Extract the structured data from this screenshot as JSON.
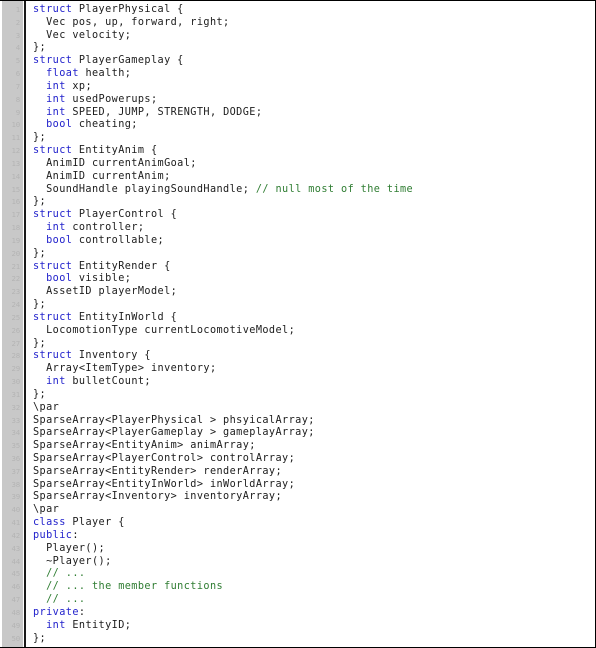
{
  "listing": {
    "language": "C++",
    "first_line_number": 1,
    "total_lines": 50,
    "colors": {
      "background": "#ffffff",
      "gutter": "#c8c8c8",
      "gutter_rule": "#1a1a1a",
      "line_number": "#b4b4b4",
      "text": "#1c1c1c",
      "keyword": "#2222cc",
      "comment": "#2f7d32",
      "border": "#000000"
    },
    "lines": [
      {
        "n": "1",
        "tokens": [
          {
            "t": "kw",
            "s": "struct"
          },
          {
            "t": "txt",
            "s": " PlayerPhysical {"
          }
        ]
      },
      {
        "n": "2",
        "tokens": [
          {
            "t": "txt",
            "s": "  Vec pos, up, forward, right;"
          }
        ]
      },
      {
        "n": "3",
        "tokens": [
          {
            "t": "txt",
            "s": "  Vec velocity;"
          }
        ]
      },
      {
        "n": "4",
        "tokens": [
          {
            "t": "txt",
            "s": "};"
          }
        ]
      },
      {
        "n": "5",
        "tokens": [
          {
            "t": "kw",
            "s": "struct"
          },
          {
            "t": "txt",
            "s": " PlayerGameplay {"
          }
        ]
      },
      {
        "n": "6",
        "tokens": [
          {
            "t": "txt",
            "s": "  "
          },
          {
            "t": "kw",
            "s": "float"
          },
          {
            "t": "txt",
            "s": " health;"
          }
        ]
      },
      {
        "n": "7",
        "tokens": [
          {
            "t": "txt",
            "s": "  "
          },
          {
            "t": "kw",
            "s": "int"
          },
          {
            "t": "txt",
            "s": " xp;"
          }
        ]
      },
      {
        "n": "8",
        "tokens": [
          {
            "t": "txt",
            "s": "  "
          },
          {
            "t": "kw",
            "s": "int"
          },
          {
            "t": "txt",
            "s": " usedPowerups;"
          }
        ]
      },
      {
        "n": "9",
        "tokens": [
          {
            "t": "txt",
            "s": "  "
          },
          {
            "t": "kw",
            "s": "int"
          },
          {
            "t": "txt",
            "s": " SPEED, JUMP, STRENGTH, DODGE;"
          }
        ]
      },
      {
        "n": "10",
        "tokens": [
          {
            "t": "txt",
            "s": "  "
          },
          {
            "t": "kw",
            "s": "bool"
          },
          {
            "t": "txt",
            "s": " cheating;"
          }
        ]
      },
      {
        "n": "11",
        "tokens": [
          {
            "t": "txt",
            "s": "};"
          }
        ]
      },
      {
        "n": "12",
        "tokens": [
          {
            "t": "kw",
            "s": "struct"
          },
          {
            "t": "txt",
            "s": " EntityAnim {"
          }
        ]
      },
      {
        "n": "13",
        "tokens": [
          {
            "t": "txt",
            "s": "  AnimID currentAnimGoal;"
          }
        ]
      },
      {
        "n": "14",
        "tokens": [
          {
            "t": "txt",
            "s": "  AnimID currentAnim;"
          }
        ]
      },
      {
        "n": "15",
        "tokens": [
          {
            "t": "txt",
            "s": "  SoundHandle playingSoundHandle; "
          },
          {
            "t": "cmt",
            "s": "// null most of the time"
          }
        ]
      },
      {
        "n": "16",
        "tokens": [
          {
            "t": "txt",
            "s": "};"
          }
        ]
      },
      {
        "n": "17",
        "tokens": [
          {
            "t": "kw",
            "s": "struct"
          },
          {
            "t": "txt",
            "s": " PlayerControl {"
          }
        ]
      },
      {
        "n": "18",
        "tokens": [
          {
            "t": "txt",
            "s": "  "
          },
          {
            "t": "kw",
            "s": "int"
          },
          {
            "t": "txt",
            "s": " controller;"
          }
        ]
      },
      {
        "n": "19",
        "tokens": [
          {
            "t": "txt",
            "s": "  "
          },
          {
            "t": "kw",
            "s": "bool"
          },
          {
            "t": "txt",
            "s": " controllable;"
          }
        ]
      },
      {
        "n": "20",
        "tokens": [
          {
            "t": "txt",
            "s": "};"
          }
        ]
      },
      {
        "n": "21",
        "tokens": [
          {
            "t": "kw",
            "s": "struct"
          },
          {
            "t": "txt",
            "s": " EntityRender {"
          }
        ]
      },
      {
        "n": "22",
        "tokens": [
          {
            "t": "txt",
            "s": "  "
          },
          {
            "t": "kw",
            "s": "bool"
          },
          {
            "t": "txt",
            "s": " visible;"
          }
        ]
      },
      {
        "n": "23",
        "tokens": [
          {
            "t": "txt",
            "s": "  AssetID playerModel;"
          }
        ]
      },
      {
        "n": "24",
        "tokens": [
          {
            "t": "txt",
            "s": "};"
          }
        ]
      },
      {
        "n": "25",
        "tokens": [
          {
            "t": "kw",
            "s": "struct"
          },
          {
            "t": "txt",
            "s": " EntityInWorld {"
          }
        ]
      },
      {
        "n": "26",
        "tokens": [
          {
            "t": "txt",
            "s": "  LocomotionType currentLocomotiveModel;"
          }
        ]
      },
      {
        "n": "27",
        "tokens": [
          {
            "t": "txt",
            "s": "};"
          }
        ]
      },
      {
        "n": "28",
        "tokens": [
          {
            "t": "kw",
            "s": "struct"
          },
          {
            "t": "txt",
            "s": " Inventory {"
          }
        ]
      },
      {
        "n": "29",
        "tokens": [
          {
            "t": "txt",
            "s": "  Array<ItemType> inventory;"
          }
        ]
      },
      {
        "n": "30",
        "tokens": [
          {
            "t": "txt",
            "s": "  "
          },
          {
            "t": "kw",
            "s": "int"
          },
          {
            "t": "txt",
            "s": " bulletCount;"
          }
        ]
      },
      {
        "n": "31",
        "tokens": [
          {
            "t": "txt",
            "s": "};"
          }
        ]
      },
      {
        "n": "32",
        "tokens": [
          {
            "t": "txt",
            "s": "\\par"
          }
        ]
      },
      {
        "n": "33",
        "tokens": [
          {
            "t": "txt",
            "s": "SparseArray<PlayerPhysical > phsyicalArray;"
          }
        ]
      },
      {
        "n": "34",
        "tokens": [
          {
            "t": "txt",
            "s": "SparseArray<PlayerGameplay > gameplayArray;"
          }
        ]
      },
      {
        "n": "35",
        "tokens": [
          {
            "t": "txt",
            "s": "SparseArray<EntityAnim> animArray;"
          }
        ]
      },
      {
        "n": "36",
        "tokens": [
          {
            "t": "txt",
            "s": "SparseArray<PlayerControl> controlArray;"
          }
        ]
      },
      {
        "n": "37",
        "tokens": [
          {
            "t": "txt",
            "s": "SparseArray<EntityRender> renderArray;"
          }
        ]
      },
      {
        "n": "38",
        "tokens": [
          {
            "t": "txt",
            "s": "SparseArray<EntityInWorld> inWorldArray;"
          }
        ]
      },
      {
        "n": "39",
        "tokens": [
          {
            "t": "txt",
            "s": "SparseArray<Inventory> inventoryArray;"
          }
        ]
      },
      {
        "n": "40",
        "tokens": [
          {
            "t": "txt",
            "s": "\\par"
          }
        ]
      },
      {
        "n": "41",
        "tokens": [
          {
            "t": "kw",
            "s": "class"
          },
          {
            "t": "txt",
            "s": " Player {"
          }
        ]
      },
      {
        "n": "42",
        "tokens": [
          {
            "t": "kw",
            "s": "public"
          },
          {
            "t": "txt",
            "s": ":"
          }
        ]
      },
      {
        "n": "43",
        "tokens": [
          {
            "t": "txt",
            "s": "  Player();"
          }
        ]
      },
      {
        "n": "44",
        "tokens": [
          {
            "t": "txt",
            "s": "  ~Player();"
          }
        ]
      },
      {
        "n": "45",
        "tokens": [
          {
            "t": "txt",
            "s": "  "
          },
          {
            "t": "cmt",
            "s": "// ..."
          }
        ]
      },
      {
        "n": "46",
        "tokens": [
          {
            "t": "txt",
            "s": "  "
          },
          {
            "t": "cmt",
            "s": "// ... the member functions"
          }
        ]
      },
      {
        "n": "47",
        "tokens": [
          {
            "t": "txt",
            "s": "  "
          },
          {
            "t": "cmt",
            "s": "// ..."
          }
        ]
      },
      {
        "n": "48",
        "tokens": [
          {
            "t": "kw",
            "s": "private"
          },
          {
            "t": "txt",
            "s": ":"
          }
        ]
      },
      {
        "n": "49",
        "tokens": [
          {
            "t": "txt",
            "s": "  "
          },
          {
            "t": "kw",
            "s": "int"
          },
          {
            "t": "txt",
            "s": " EntityID;"
          }
        ]
      },
      {
        "n": "50",
        "tokens": [
          {
            "t": "txt",
            "s": "};"
          }
        ]
      }
    ]
  }
}
